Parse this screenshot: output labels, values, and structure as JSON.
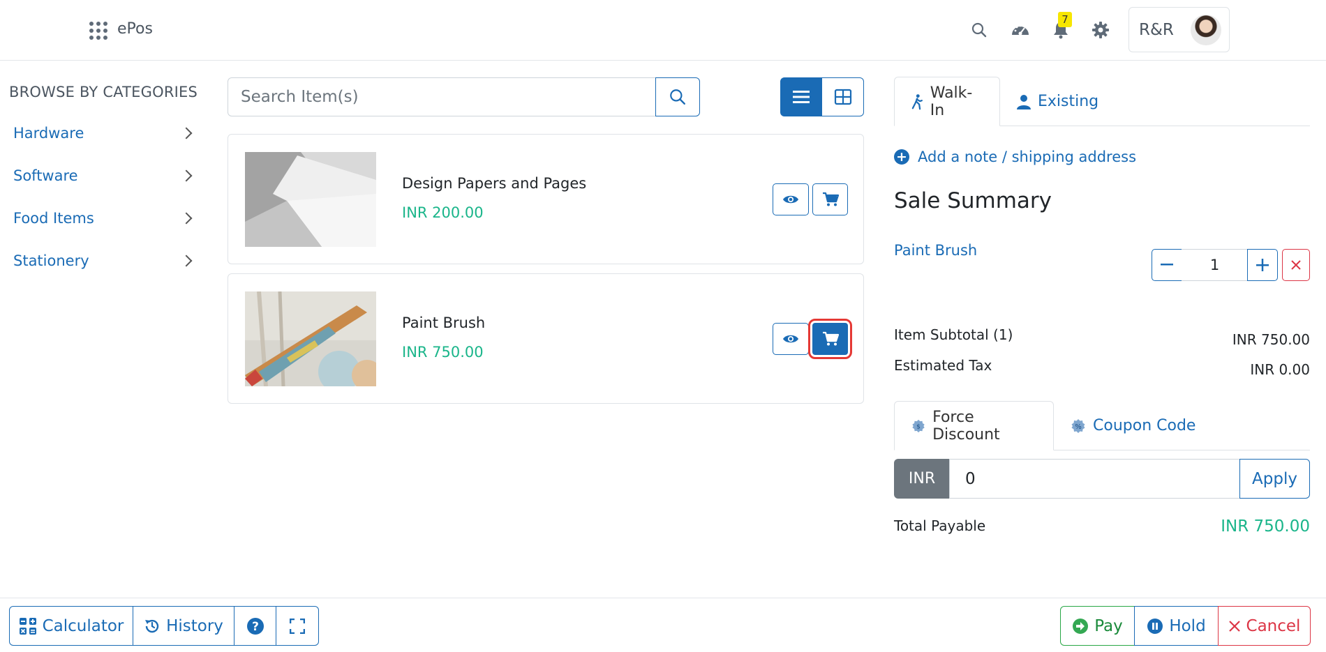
{
  "header": {
    "app_title": "ePos",
    "notification_count": "7",
    "user_label": "R&R"
  },
  "categories": {
    "heading": "BROWSE BY CATEGORIES",
    "items": [
      {
        "label": "Hardware"
      },
      {
        "label": "Software"
      },
      {
        "label": "Food Items"
      },
      {
        "label": "Stationery"
      }
    ]
  },
  "search": {
    "placeholder": "Search Item(s)",
    "value": ""
  },
  "products": [
    {
      "name": "Design Papers and Pages",
      "price": "INR 200.00"
    },
    {
      "name": "Paint Brush",
      "price": "INR 750.00"
    }
  ],
  "customer_tabs": {
    "walkin": "Walk-In",
    "existing": "Existing"
  },
  "note_link": "Add a note / shipping address",
  "sale_summary": {
    "title": "Sale Summary",
    "line_items": [
      {
        "name": "Paint Brush",
        "qty": "1"
      }
    ],
    "subtotal_label": "Item Subtotal (1)",
    "subtotal_value": "INR 750.00",
    "tax_label": "Estimated Tax",
    "tax_value": "INR 0.00",
    "discount_tabs": {
      "force": "Force Discount",
      "coupon": "Coupon Code"
    },
    "discount_currency": "INR",
    "discount_value": "0",
    "apply_label": "Apply",
    "total_label": "Total Payable",
    "total_value": "INR 750.00"
  },
  "footer": {
    "calculator": "Calculator",
    "history": "History",
    "pay": "Pay",
    "hold": "Hold",
    "cancel": "Cancel"
  },
  "colors": {
    "primary": "#1a6bb5",
    "success": "#1ab58a",
    "danger": "#dc3545",
    "badge": "#f7e600"
  }
}
